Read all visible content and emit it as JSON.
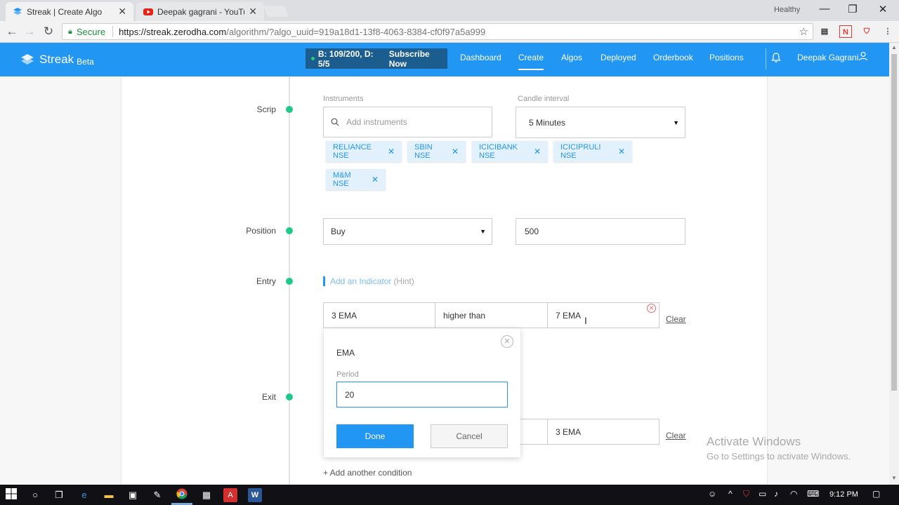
{
  "browser": {
    "tabs": [
      {
        "title": "Streak | Create Algo",
        "close": "✕"
      },
      {
        "title": "Deepak gagrani - YouTu",
        "close": "✕"
      }
    ],
    "profile_label": "Healthy",
    "window_controls": {
      "minimize": "—",
      "restore": "❐",
      "close": "✕"
    },
    "secure_label": "Secure",
    "url_host": "https://streak.zerodha.com",
    "url_path": "/algorithm/?algo_uuid=919a18d1-13f8-4063-8384-cf0f97a5a999"
  },
  "header": {
    "logo_text": "Streak",
    "logo_beta": "Beta",
    "subscription": "B: 109/200, D: 5/5",
    "subscribe_cta": "Subscribe Now",
    "nav": [
      "Dashboard",
      "Create",
      "Algos",
      "Deployed",
      "Orderbook",
      "Positions"
    ],
    "active_nav": "Create",
    "user_name": "Deepak Gagrani"
  },
  "scrip": {
    "label": "Scrip",
    "instruments_label": "Instruments",
    "instruments_placeholder": "Add instruments",
    "candle_label": "Candle interval",
    "candle_value": "5 Minutes",
    "chips": [
      "RELIANCE NSE",
      "SBIN NSE",
      "ICICIBANK NSE",
      "ICICIPRULI NSE",
      "M&M NSE"
    ]
  },
  "position": {
    "label": "Position",
    "side_value": "Buy",
    "quantity_value": "500"
  },
  "entry": {
    "label": "Entry",
    "add_indicator": "Add an Indicator",
    "hint": "(Hint)",
    "condition": {
      "left": "3 EMA",
      "operator": "higher than",
      "right": "7 EMA"
    },
    "clear": "Clear"
  },
  "exit": {
    "label": "Exit",
    "right_value": "3 EMA",
    "clear": "Clear",
    "add_condition": "+ Add another condition"
  },
  "popup": {
    "title": "EMA",
    "period_label": "Period",
    "period_value": "20",
    "done": "Done",
    "cancel": "Cancel"
  },
  "watermark": {
    "title": "Activate Windows",
    "subtitle": "Go to Settings to activate Windows."
  },
  "taskbar": {
    "time": "9:12 PM"
  },
  "colors": {
    "brand_blue": "#2196f3",
    "timeline_green": "#1ec98a",
    "chip_bg": "#e3f1fd"
  }
}
